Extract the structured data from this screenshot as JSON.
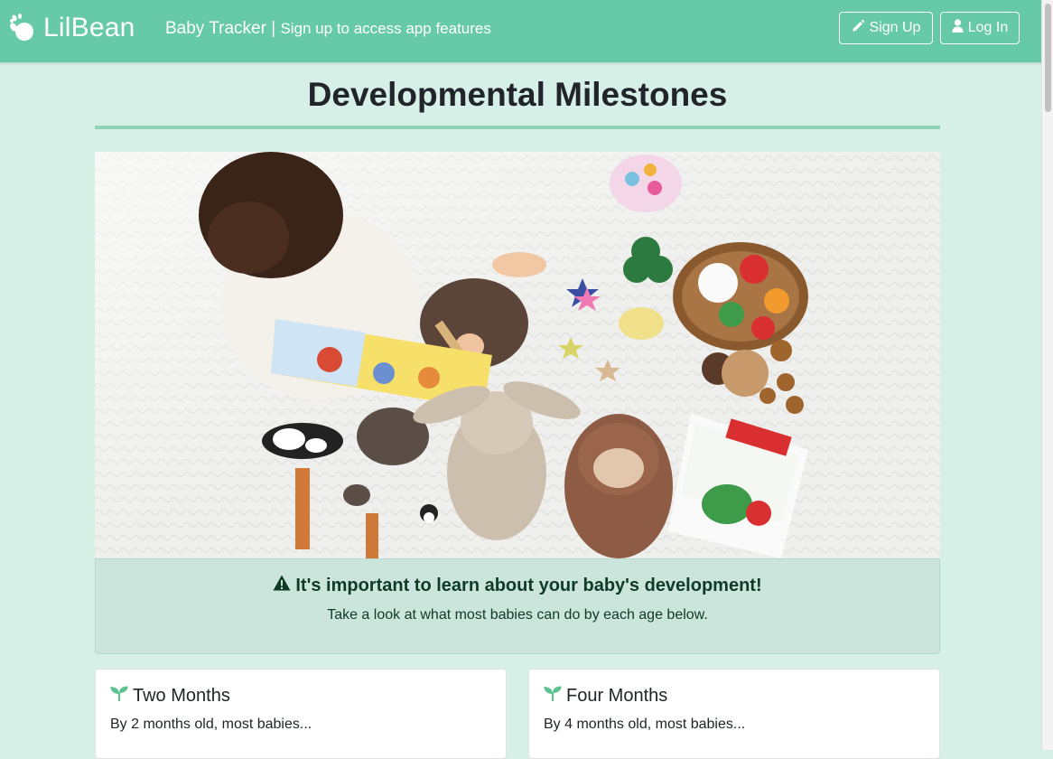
{
  "navbar": {
    "brand_name": "LilBean",
    "subtitle_main": "Baby Tracker |",
    "subtitle_small": "Sign up to access app features",
    "signup_label": "Sign Up",
    "login_label": "Log In",
    "background_color": "#66c9a8"
  },
  "page": {
    "title": "Developmental Milestones",
    "background_color": "#d6efe7",
    "accent_color": "#8fd4b6"
  },
  "hero": {
    "icon_name": "hero-photo-baby-toys"
  },
  "alert": {
    "title": "It's important to learn about your baby's development!",
    "text": "Take a look at what most babies can do by each age below.",
    "icon_name": "warning-triangle-icon"
  },
  "milestones": [
    {
      "title": "Two Months",
      "text": "By 2 months old, most babies...",
      "icon_name": "seedling-icon"
    },
    {
      "title": "Four Months",
      "text": "By 4 months old, most babies...",
      "icon_name": "seedling-icon"
    }
  ]
}
